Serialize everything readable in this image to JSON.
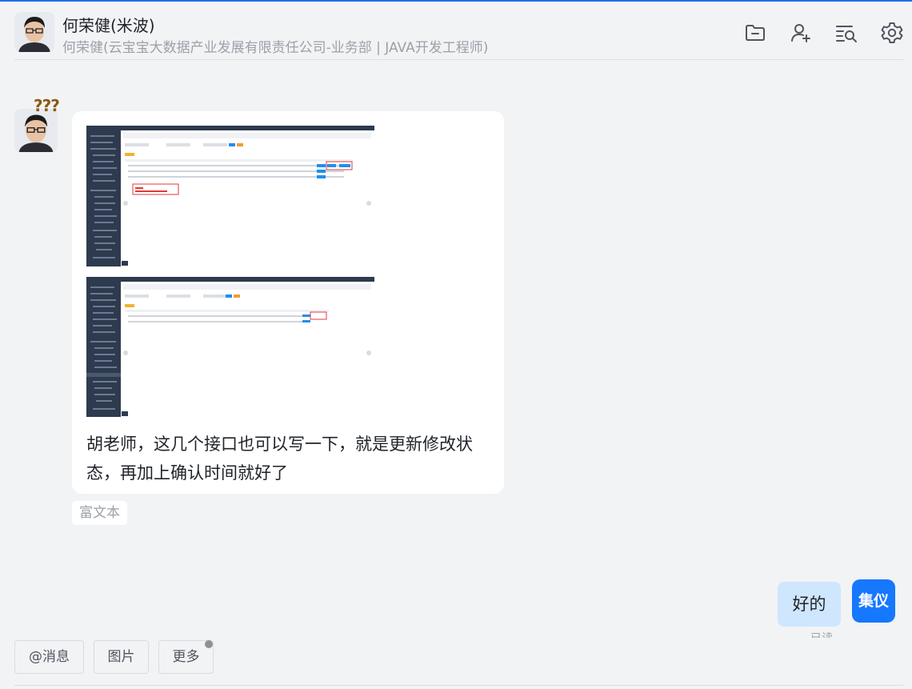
{
  "header": {
    "name": "何荣健(米波)",
    "subtitle": "何荣健(云宝宝大数据产业发展有限责任公司-业务部 | JAVA开发工程师)",
    "icons": [
      "folder-icon",
      "add-user-icon",
      "search-history-icon",
      "settings-icon"
    ]
  },
  "message": {
    "sender_status_marks": "???",
    "text": "胡老师，这几个接口也可以写一下，就是更新修改状态，再加上确认时间就好了",
    "tag": "富文本"
  },
  "reply": {
    "text": "好的",
    "avatar_text": "集仪",
    "status": "已读"
  },
  "toolbar": {
    "mention": "@消息",
    "image": "图片",
    "more": "更多"
  },
  "colors": {
    "accent": "#1677ff",
    "reply_bubble": "#cfe6ff",
    "background": "#f2f3f5"
  }
}
